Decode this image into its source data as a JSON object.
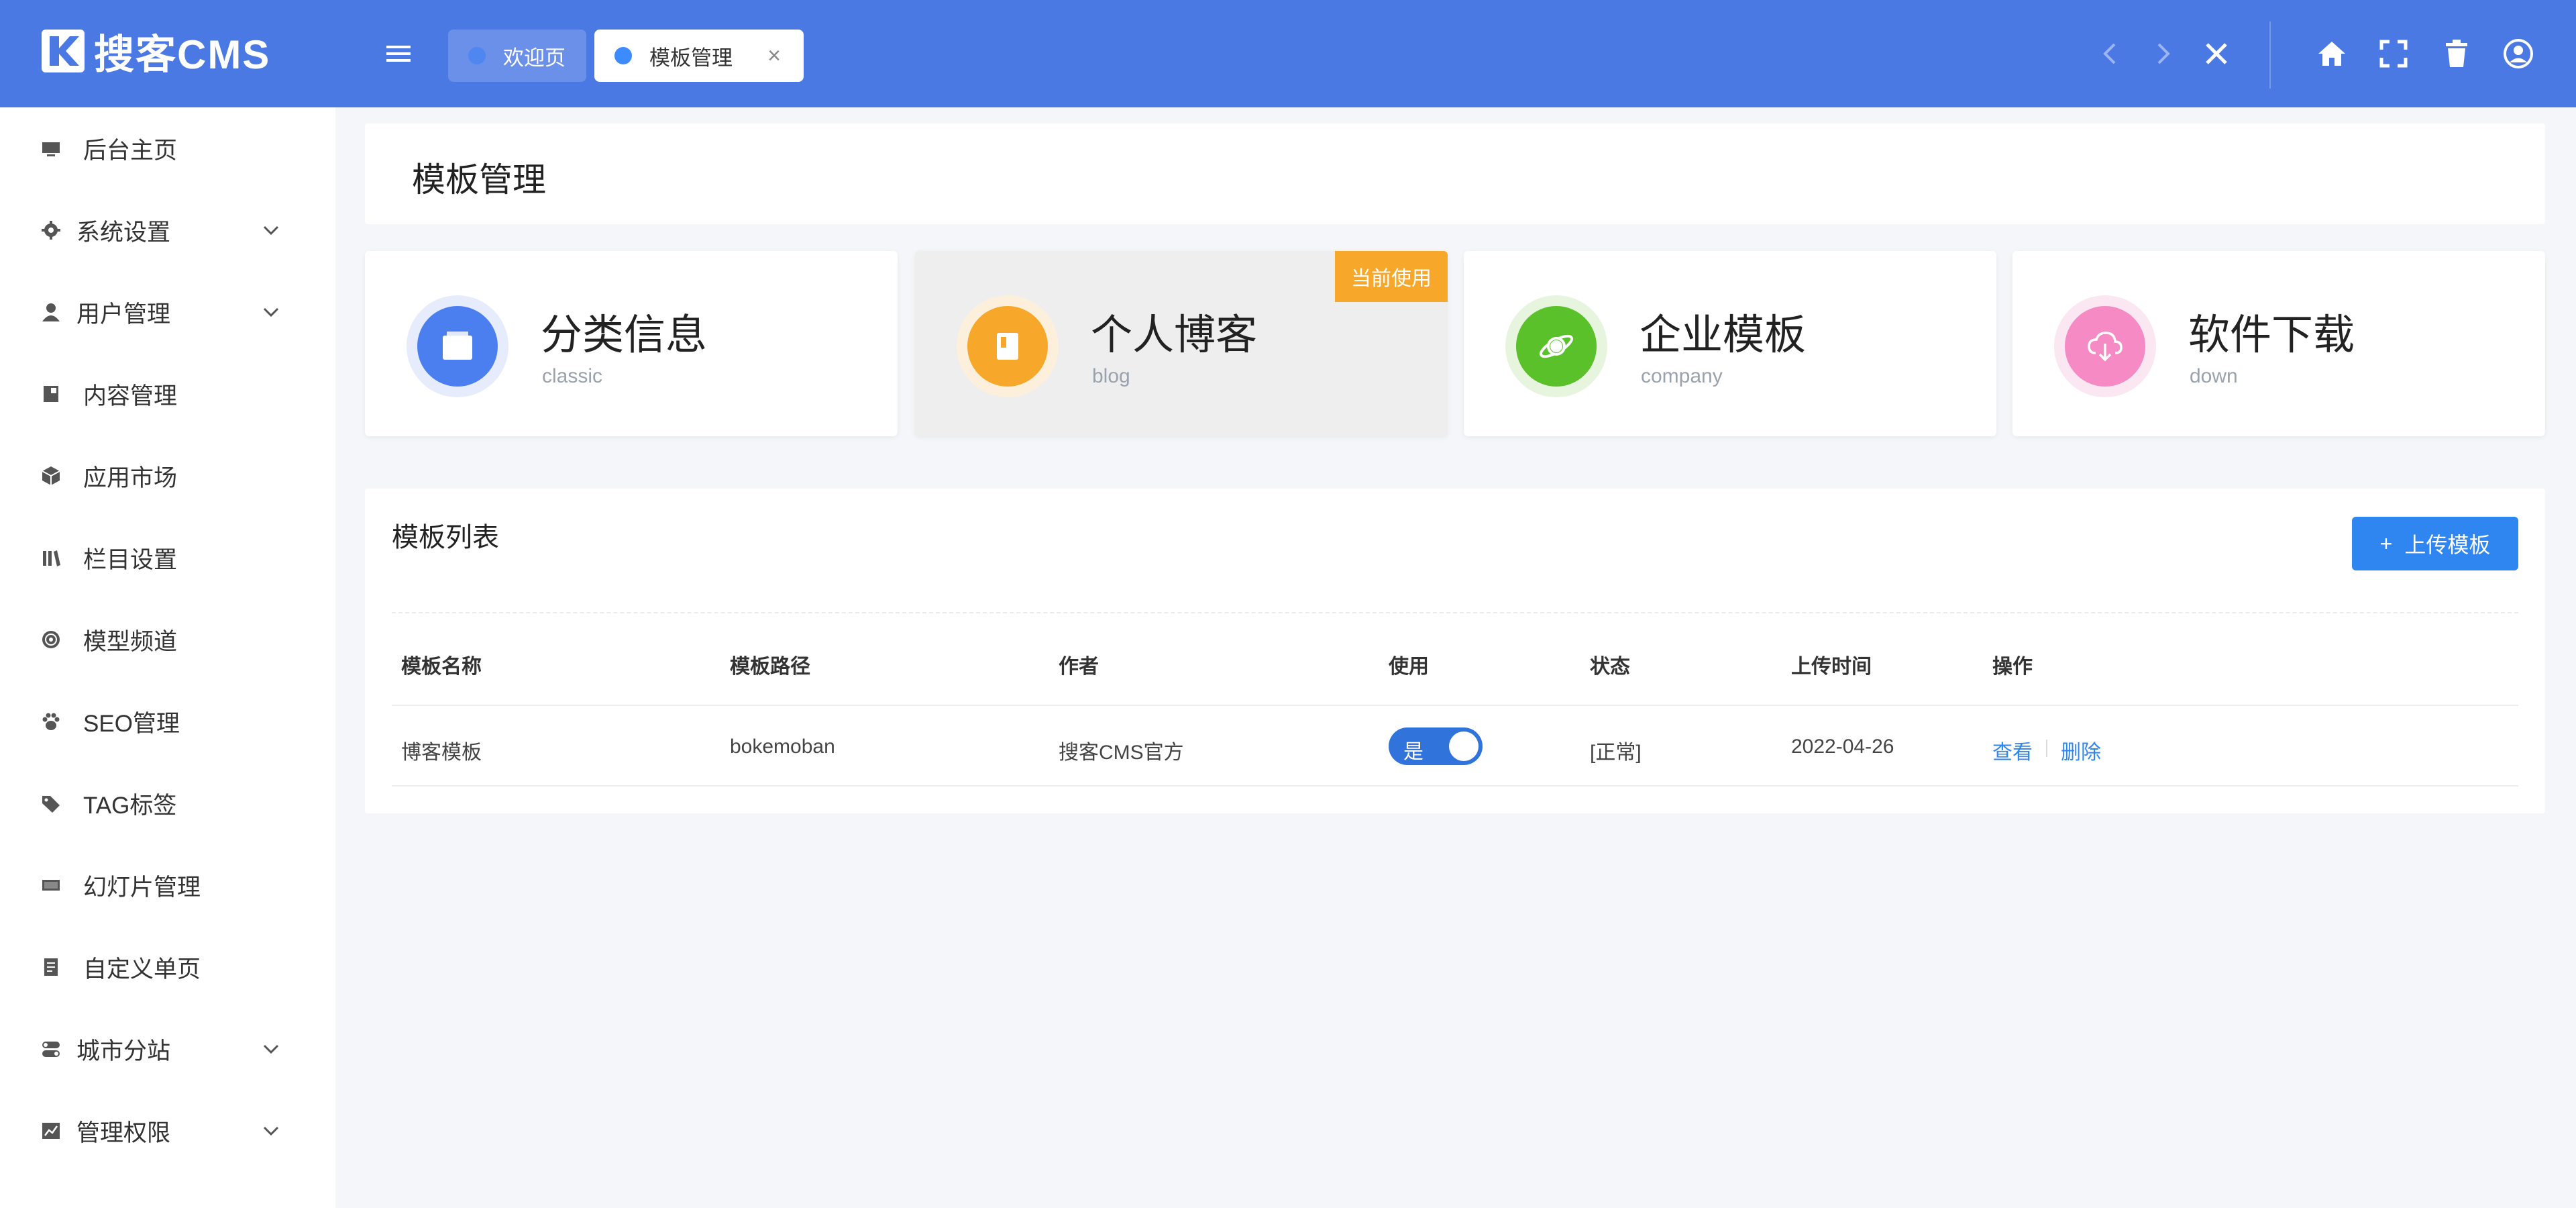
{
  "header": {
    "logo_text": "搜客CMS",
    "tabs": [
      {
        "label": "欢迎页",
        "active": false
      },
      {
        "label": "模板管理",
        "active": true
      }
    ],
    "tab_close_glyph": "×",
    "icons": [
      "menu-icon",
      "chevron-left-icon",
      "chevron-right-icon",
      "close-icon",
      "home-icon",
      "fullscreen-icon",
      "trash-icon",
      "user-circle-icon"
    ],
    "colors": {
      "bar": "#4b79e3",
      "tab_dot": "#3d8bff"
    }
  },
  "sidebar": {
    "items": [
      {
        "label": "后台主页",
        "icon": "monitor-icon",
        "expandable": false
      },
      {
        "label": "系统设置",
        "icon": "gear-icon",
        "expandable": true
      },
      {
        "label": "用户管理",
        "icon": "user-icon",
        "expandable": true
      },
      {
        "label": "内容管理",
        "icon": "book-icon",
        "expandable": false
      },
      {
        "label": "应用市场",
        "icon": "cube-icon",
        "expandable": false
      },
      {
        "label": "栏目设置",
        "icon": "library-icon",
        "expandable": false
      },
      {
        "label": "模型频道",
        "icon": "globe-icon",
        "expandable": false
      },
      {
        "label": "SEO管理",
        "icon": "paw-icon",
        "expandable": false
      },
      {
        "label": "TAG标签",
        "icon": "tags-icon",
        "expandable": false
      },
      {
        "label": "幻灯片管理",
        "icon": "slides-icon",
        "expandable": false
      },
      {
        "label": "自定义单页",
        "icon": "page-icon",
        "expandable": false
      },
      {
        "label": "城市分站",
        "icon": "toggle-icon",
        "expandable": true
      },
      {
        "label": "管理权限",
        "icon": "chart-icon",
        "expandable": true
      }
    ]
  },
  "page": {
    "title": "模板管理"
  },
  "cards": [
    {
      "name": "分类信息",
      "code": "classic",
      "icon": "folder-icon",
      "color": "#4b7ff0",
      "ring": "#e6ecfb"
    },
    {
      "name": "个人博客",
      "code": "blog",
      "icon": "notebook-icon",
      "color": "#f7a82b",
      "ring": "#fcf0dc",
      "badge": "当前使用"
    },
    {
      "name": "企业模板",
      "code": "company",
      "icon": "planet-icon",
      "color": "#5ac12a",
      "ring": "#e7f5de"
    },
    {
      "name": "软件下载",
      "code": "down",
      "icon": "cloud-download-icon",
      "color": "#f58ac4",
      "ring": "#fbe7f1"
    }
  ],
  "list": {
    "title": "模板列表",
    "upload_label": "上传模板",
    "upload_glyph": "+",
    "columns": [
      "模板名称",
      "模板路径",
      "作者",
      "使用",
      "状态",
      "上传时间",
      "操作"
    ],
    "rows": [
      {
        "name": "博客模板",
        "path": "bokemoban",
        "author": "搜客CMS官方",
        "in_use_label": "是",
        "in_use": true,
        "status": "[正常]",
        "uploaded": "2022-04-26",
        "actions": [
          "查看",
          "删除"
        ]
      }
    ]
  }
}
